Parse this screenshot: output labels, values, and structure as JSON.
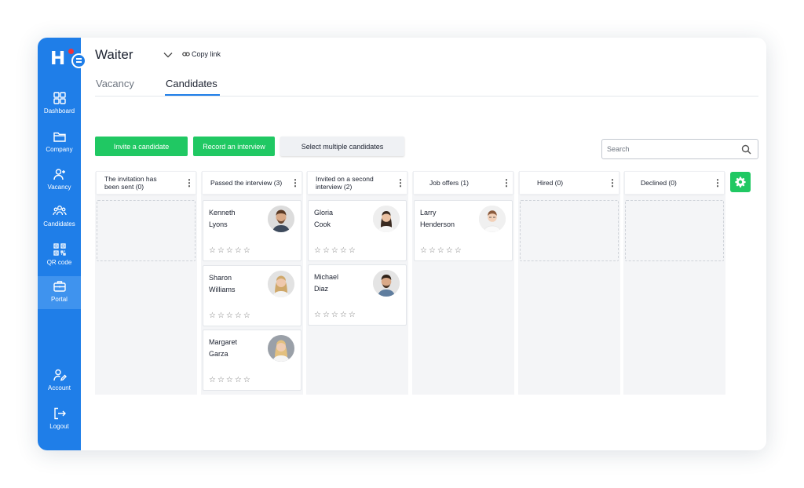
{
  "sidebar": {
    "logo_text": "H",
    "items": [
      {
        "label": "Dashboard",
        "icon": "dashboard-icon"
      },
      {
        "label": "Company",
        "icon": "folder-icon"
      },
      {
        "label": "Vacancy",
        "icon": "user-plus-icon"
      },
      {
        "label": "Candidates",
        "icon": "users-icon"
      },
      {
        "label": "QR code",
        "icon": "qr-code-icon"
      },
      {
        "label": "Portal",
        "icon": "briefcase-icon",
        "active": true
      },
      {
        "label": "Account",
        "icon": "user-edit-icon"
      },
      {
        "label": "Logout",
        "icon": "logout-icon"
      }
    ]
  },
  "header": {
    "title": "Waiter",
    "copy_link": "Copy link"
  },
  "tabs": [
    {
      "label": "Vacancy",
      "active": false
    },
    {
      "label": "Candidates",
      "active": true
    }
  ],
  "toolbar": {
    "invite_label": "Invite a candidate",
    "record_label": "Record an interview",
    "select_label": "Select multiple candidates",
    "search_placeholder": "Search"
  },
  "columns": [
    {
      "title": "The invitation has been sent (0)",
      "cards": []
    },
    {
      "title": "Passed the interview (3)",
      "cards": [
        {
          "first": "Kenneth",
          "last": "Lyons",
          "rating": 0
        },
        {
          "first": "Sharon",
          "last": "Williams",
          "rating": 0
        },
        {
          "first": "Margaret",
          "last": "Garza",
          "rating": 0
        }
      ]
    },
    {
      "title": "Invited on a second interview (2)",
      "cards": [
        {
          "first": "Gloria",
          "last": "Cook",
          "rating": 0
        },
        {
          "first": "Michael",
          "last": "Diaz",
          "rating": 0
        }
      ]
    },
    {
      "title": "Job offers (1)",
      "cards": [
        {
          "first": "Larry",
          "last": "Henderson",
          "rating": 0
        }
      ]
    },
    {
      "title": "Hired (0)",
      "cards": []
    },
    {
      "title": "Declined (0)",
      "cards": []
    }
  ],
  "stars": "☆☆☆☆☆",
  "colors": {
    "primary": "#1f7ee8",
    "accent_green": "#20c863",
    "logo_dot": "#f0323c"
  }
}
